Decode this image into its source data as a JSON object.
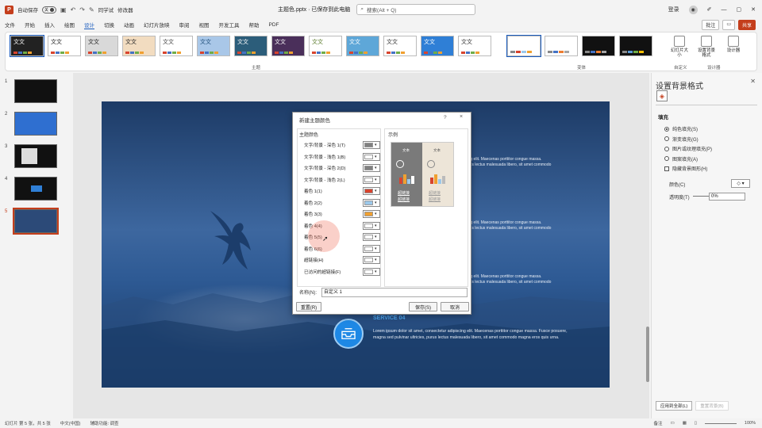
{
  "titlebar": {
    "autosave_label": "自动保存",
    "toggle_state": "关",
    "doc_title": "主题色.pptx · 已保存到此电脑",
    "search_placeholder": "搜索(Alt + Q)",
    "section_label": "同学试",
    "editor_label": "修改器",
    "user_label": "登录"
  },
  "menubar": {
    "tabs": [
      "文件",
      "开始",
      "插入",
      "绘图",
      "设计",
      "切换",
      "动画",
      "幻灯片放映",
      "审阅",
      "视图",
      "开发工具",
      "帮助",
      "PDF"
    ],
    "active_index": 4,
    "comment_label": "批注",
    "share_label": "共享"
  },
  "ribbon": {
    "themes": [
      {
        "label": "文文",
        "bg": "#222222",
        "fg": "#ffffff"
      },
      {
        "label": "文文",
        "bg": "#ffffff",
        "fg": "#222222"
      },
      {
        "label": "文文",
        "bg": "#d9d9d9",
        "fg": "#222222"
      },
      {
        "label": "文文",
        "bg": "#f2dcc0",
        "fg": "#222222"
      },
      {
        "label": "文文",
        "bg": "#ffffff",
        "fg": "#444444"
      },
      {
        "label": "文文",
        "bg": "#a9c7e8",
        "fg": "#1f4e79"
      },
      {
        "label": "文文",
        "bg": "#2c5d7a",
        "fg": "#ffffff"
      },
      {
        "label": "文文",
        "bg": "#4a2f5a",
        "fg": "#ffffff"
      },
      {
        "label": "文文",
        "bg": "#ffffff",
        "fg": "#5a7a2a"
      },
      {
        "label": "文文",
        "bg": "#5ea7d8",
        "fg": "#ffffff"
      },
      {
        "label": "文文",
        "bg": "#ffffff",
        "fg": "#333333"
      },
      {
        "label": "文文",
        "bg": "#2f7fd6",
        "fg": "#ffffff"
      },
      {
        "label": "文文",
        "bg": "#ffffff",
        "fg": "#333333"
      }
    ],
    "themes_group_label": "主题",
    "variants_group_label": "变体",
    "custom_group_label": "自定义",
    "designer_group_label": "设计器",
    "tools": [
      {
        "label": "幻灯片大小"
      },
      {
        "label": "设置背景格式"
      },
      {
        "label": "设计器"
      }
    ]
  },
  "slides": [
    {
      "num": "1",
      "current": false
    },
    {
      "num": "2",
      "current": false
    },
    {
      "num": "3",
      "current": false
    },
    {
      "num": "4",
      "current": false
    },
    {
      "num": "5",
      "current": true
    }
  ],
  "slide": {
    "lorem_line1": "cing elit. Maecenas porttitor congue massa.",
    "lorem_line2": "puus lectus malesuada libero, sit amet commodo",
    "service_title": "SERVICE 04",
    "service_body": "Lorem ipsum dolor sit amet, consectetur adipiscing elit. Maecenas porttitor congue massa. Fusce posuere, magna sed pulvinar ultricies, purus lectus malesuada libero, sit amet commodo magna eros quis urna."
  },
  "dialog": {
    "title": "新建主题颜色",
    "help": "?",
    "close": "×",
    "theme_colors_label": "主题颜色",
    "preview_label": "示例",
    "rows": [
      {
        "label": "文字/背景 - 深色 1(T)",
        "color": "#808080"
      },
      {
        "label": "文字/背景 - 浅色 1(B)",
        "color": "#ffffff"
      },
      {
        "label": "文字/背景 - 深色 2(D)",
        "color": "#808080"
      },
      {
        "label": "文字/背景 - 浅色 2(L)",
        "color": "#ffffff"
      },
      {
        "label": "着色 1(1)",
        "color": "#d8442e"
      },
      {
        "label": "着色 2(2)",
        "color": "#9cc8ea"
      },
      {
        "label": "着色 3(3)",
        "color": "#f0a030"
      },
      {
        "label": "着色 4(4)",
        "color": "#ffffff"
      },
      {
        "label": "着色 5(5)",
        "color": "#ffffff"
      },
      {
        "label": "着色 6(6)",
        "color": "#ffffff"
      },
      {
        "label": "超链接(H)",
        "color": "#ffffff"
      },
      {
        "label": "已访问的超链接(F)",
        "color": "#ffffff"
      }
    ],
    "preview_text": "文本",
    "preview_link1": "超链接",
    "preview_link2": "超链接",
    "name_label": "名称(N):",
    "name_value": "自定义 1",
    "reset_button": "重置(R)",
    "save_button": "保存(S)",
    "cancel_button": "取消"
  },
  "format_pane": {
    "title": "设置背景格式",
    "fill_section": "填充",
    "options": [
      {
        "label": "纯色填充(S)",
        "type": "radio",
        "on": true
      },
      {
        "label": "渐变填充(G)",
        "type": "radio",
        "on": false
      },
      {
        "label": "图片或纹理填充(P)",
        "type": "radio",
        "on": false
      },
      {
        "label": "图案填充(A)",
        "type": "radio",
        "on": false
      },
      {
        "label": "隐藏背景图形(H)",
        "type": "check",
        "on": false
      }
    ],
    "color_label": "颜色(C)",
    "transparency_label": "透明度(T)",
    "transparency_value": "0%",
    "apply_all_button": "应用到全部(L)",
    "reset_bg_button": "重置背景(B)"
  },
  "statusbar": {
    "slide_info": "幻灯片 第 5 张，共 5 张",
    "language": "中文(中国)",
    "accessibility": "辅助功能: 调查",
    "notes": "备注",
    "zoom": "100%"
  },
  "icons": {
    "search": "search-icon",
    "close": "close-icon",
    "paint": "paint-bucket-icon",
    "cursor": "cursor-icon"
  }
}
